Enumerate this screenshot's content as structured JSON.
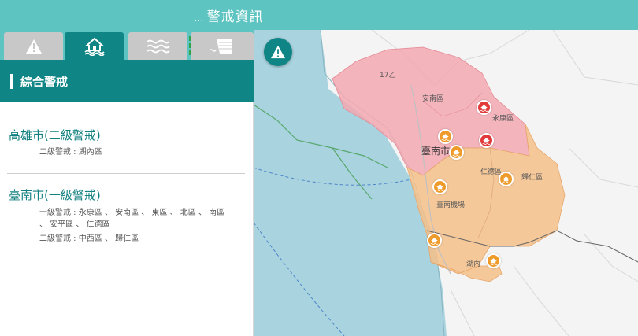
{
  "header": {
    "prefix": "...",
    "title": "警戒資訊"
  },
  "tabs": [
    {
      "icon": "warning-icon",
      "active": false
    },
    {
      "icon": "flooded-house-icon",
      "active": true
    },
    {
      "icon": "waves-icon",
      "active": false
    },
    {
      "icon": "reservoir-icon",
      "active": false
    }
  ],
  "section": {
    "label": "綜合警戒"
  },
  "alerts": [
    {
      "city": "高雄市(二級警戒)",
      "lines": [
        "二級警戒 : 湖內區"
      ]
    },
    {
      "city": "臺南市(一級警戒)",
      "lines": [
        "一級警戒 : 永康區 、 安南區 、 東區 、 北區 、 南區",
        "、 安平區 、 仁德區",
        "二級警戒 : 中西區 、 歸仁區"
      ]
    }
  ],
  "map": {
    "labels": {
      "road": "17乙",
      "annan": "安南區",
      "yongkang": "永康區",
      "tainan": "臺南市",
      "rende": "仁德區",
      "guiren": "歸仁區",
      "south": "臺南機場",
      "hunei": "湖內"
    },
    "colors": {
      "level1": "#f3a8b2",
      "level2": "#f5c08a",
      "sea": "#a9d3df",
      "red_marker": "#e23a3a",
      "orange_marker": "#ef9b2c"
    }
  }
}
